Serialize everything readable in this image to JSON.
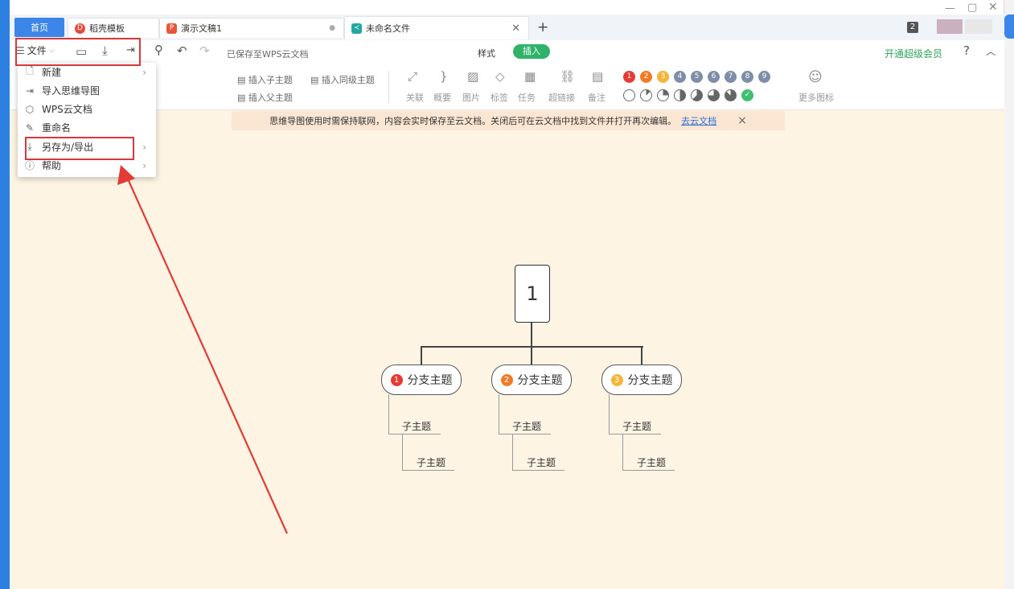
{
  "tabs": {
    "home": "首页",
    "t1": "稻壳模板",
    "t2": "演示文稿1",
    "t3": "未命名文件",
    "add": "+",
    "badge": "2"
  },
  "toolbar": {
    "file_label": "文件",
    "saved_status": "已保存至WPS云文档",
    "tab_style": "样式",
    "tab_insert": "插入",
    "vip_link": "开通超级会员",
    "help_icon_label": "?",
    "insert_child": "插入子主题",
    "insert_sibling": "插入同级主题",
    "insert_parent": "插入父主题",
    "tools": [
      "关联",
      "概要",
      "图片",
      "标签",
      "任务",
      "超链接",
      "备注"
    ],
    "more_icons": "更多图标"
  },
  "priority_colors": [
    "#e63b34",
    "#f07b26",
    "#f4b63a",
    "#7e8ea8",
    "#7e8ea8",
    "#7e8ea8",
    "#7e8ea8",
    "#7e8ea8",
    "#7e8ea8"
  ],
  "priority_labels": [
    "1",
    "2",
    "3",
    "4",
    "5",
    "6",
    "7",
    "8",
    "9"
  ],
  "notice": {
    "text": "思维导图使用时需保持联网，内容会实时保存至云文档。关闭后可在云文档中找到文件并打开再次编辑。",
    "link": "去云文档",
    "close": "×"
  },
  "file_menu": {
    "items": [
      {
        "label": "新建",
        "has_sub": true
      },
      {
        "label": "导入思维导图",
        "has_sub": false
      },
      {
        "label": "WPS云文档",
        "has_sub": false
      },
      {
        "label": "重命名",
        "has_sub": false
      },
      {
        "label": "另存为/导出",
        "has_sub": true
      },
      {
        "label": "帮助",
        "has_sub": true
      }
    ]
  },
  "mindmap": {
    "root": "1",
    "branches": [
      {
        "num": "1",
        "label": "分支主题",
        "color": "#e63b34",
        "subs": [
          "子主题",
          "子主题"
        ]
      },
      {
        "num": "2",
        "label": "分支主题",
        "color": "#f07b26",
        "subs": [
          "子主题",
          "子主题"
        ]
      },
      {
        "num": "3",
        "label": "分支主题",
        "color": "#f4b63a",
        "subs": [
          "子主题",
          "子主题"
        ]
      }
    ]
  }
}
